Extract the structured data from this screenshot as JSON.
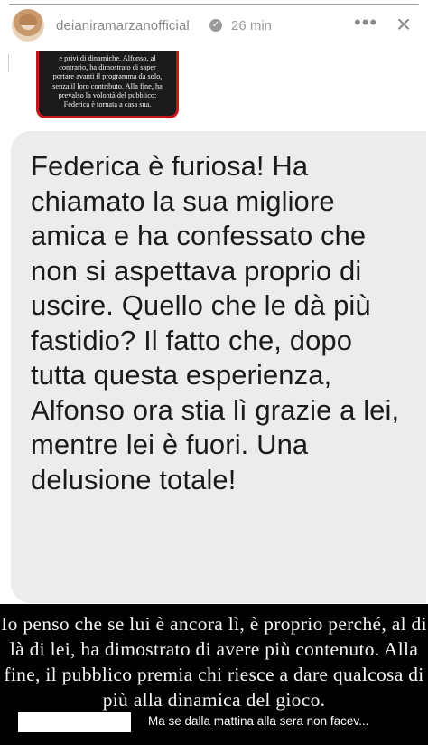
{
  "header": {
    "username": "deianiramarzanofficial",
    "verified_icon": "verified-badge-icon",
    "time": "26 min",
    "more_icon": "more-options-icon",
    "close_icon": "close-icon"
  },
  "embedded_post": {
    "lines": [
      "e privi di dinamiche. Alfonso, al",
      "contrario, ha dimostrato di saper",
      "portare avanti il programma da solo,",
      "senza il loro contributo. Alla fine, ha",
      "prevalso la volontà del pubblico:",
      "Federica è tornata a casa sua."
    ],
    "border_color": "#c4161c"
  },
  "message": {
    "text": "Federica è furiosa! Ha chiamato la sua migliore amica e ha confessato che non si aspettava proprio di uscire. Quello che le dà più fastidio? Il fatto che, dopo tutta questa esperienza, Alfonso ora stia lì grazie a lei, mentre lei è fuori. Una delusione totale!"
  },
  "caption": {
    "text": "Io penso che se lui è ancora lì, è proprio perché, al di là di lei, ha dimostrato di avere più contenuto. Alla fine, il pubblico premia chi riesce a dare qualcosa di più alla dinamica del gioco."
  },
  "reply": {
    "preview": "Ma se dalla mattina alla sera non facev..."
  },
  "colors": {
    "background": "#ffffff",
    "bubble": "#ececec",
    "caption_bg": "#000000"
  }
}
